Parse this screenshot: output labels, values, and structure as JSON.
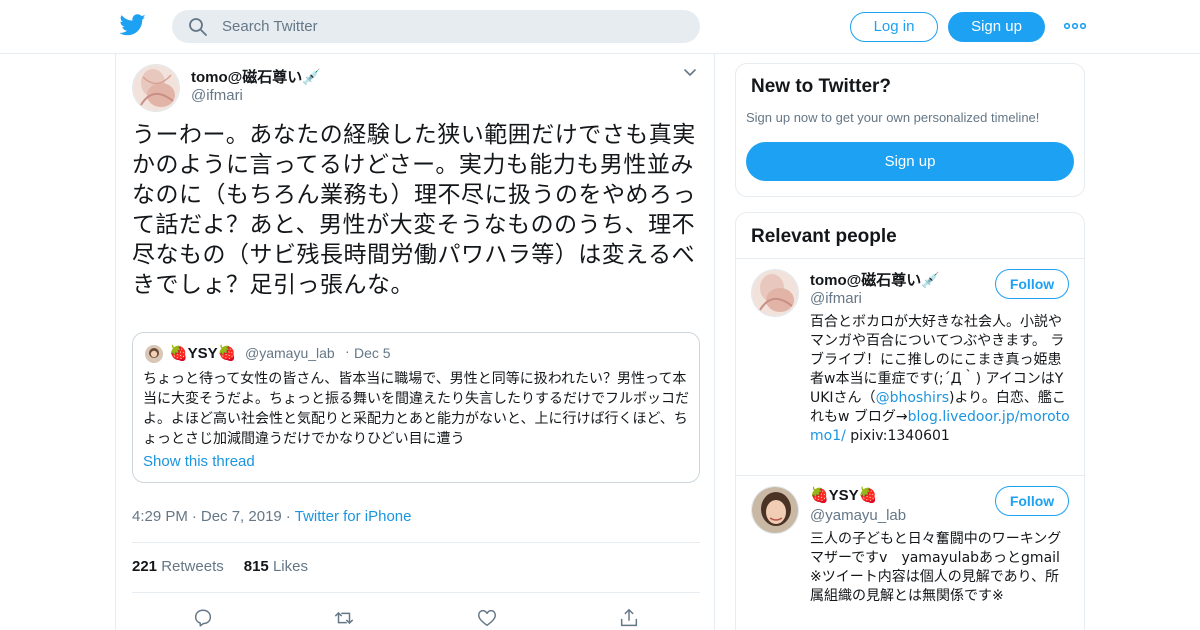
{
  "header": {
    "search_placeholder": "Search Twitter",
    "login_label": "Log in",
    "signup_label": "Sign up",
    "more_icon": "more-dots-icon",
    "brand_color": "#1da1f2"
  },
  "tweet": {
    "author_name": "tomo@磁石尊い💉",
    "author_handle": "@ifmari",
    "text": "うーわー。あなたの経験した狭い範囲だけでさも真実かのように言ってるけどさー。実力も能力も男性並みなのに（もちろん業務も）理不尽に扱うのをやめろって話だよ？あと、男性が大変そうなもののうち、理不尽なもの（サビ残長時間労働パワハラ等）は変えるべきでしょ？足引っ張んな。",
    "quote": {
      "name": "🍓YSY🍓",
      "handle": "@yamayu_lab",
      "dot": "·",
      "date": "Dec 5",
      "text": "ちょっと待って女性の皆さん、皆本当に職場で、男性と同等に扱われたい？男性って本当に大変そうだよ。ちょっと振る舞いを間違えたり失言したりするだけでフルボッコだよ。よほど高い社会性と気配りと采配力とあと能力がないと、上に行けば行くほど、ちょっとさじ加減間違うだけでかなりひどい目に遭う",
      "show_thread": "Show this thread"
    },
    "time": "4:29 PM",
    "sep": "·",
    "date": "Dec 7, 2019",
    "source": "Twitter for iPhone",
    "retweets_count": "221",
    "retweets_label": "Retweets",
    "likes_count": "815",
    "likes_label": "Likes",
    "actions": [
      "reply-icon",
      "retweet-icon",
      "like-icon",
      "share-icon"
    ]
  },
  "sidebar": {
    "new_title": "New to Twitter?",
    "new_sub": "Sign up now to get your own personalized timeline!",
    "new_signup": "Sign up",
    "relevant_title": "Relevant people",
    "people": [
      {
        "name": "tomo@磁石尊い💉",
        "handle": "@ifmari",
        "follow": "Follow",
        "bio_pre": "百合とボカロが大好きな社会人。小説やマンガや百合についてつぶやきます。 ラブライブ！にこ推しのにこまき真っ姫患者w本当に重症です(;´Д｀) アイコンはYUKIさん（",
        "bio_link1": "@bhoshirs",
        "bio_mid": ")より。白恋、艦これもw ブログ→",
        "bio_link2": "blog.livedoor.jp/morotomo1/",
        "bio_post": " pixiv:1340601"
      },
      {
        "name": "🍓YSY🍓",
        "handle": "@yamayu_lab",
        "follow": "Follow",
        "bio": "三人の子どもと日々奮闘中のワーキングマザーですv　yamayulabあっとgmail ※ツイート内容は個人の見解であり、所属組織の見解とは無関係です※"
      }
    ]
  }
}
